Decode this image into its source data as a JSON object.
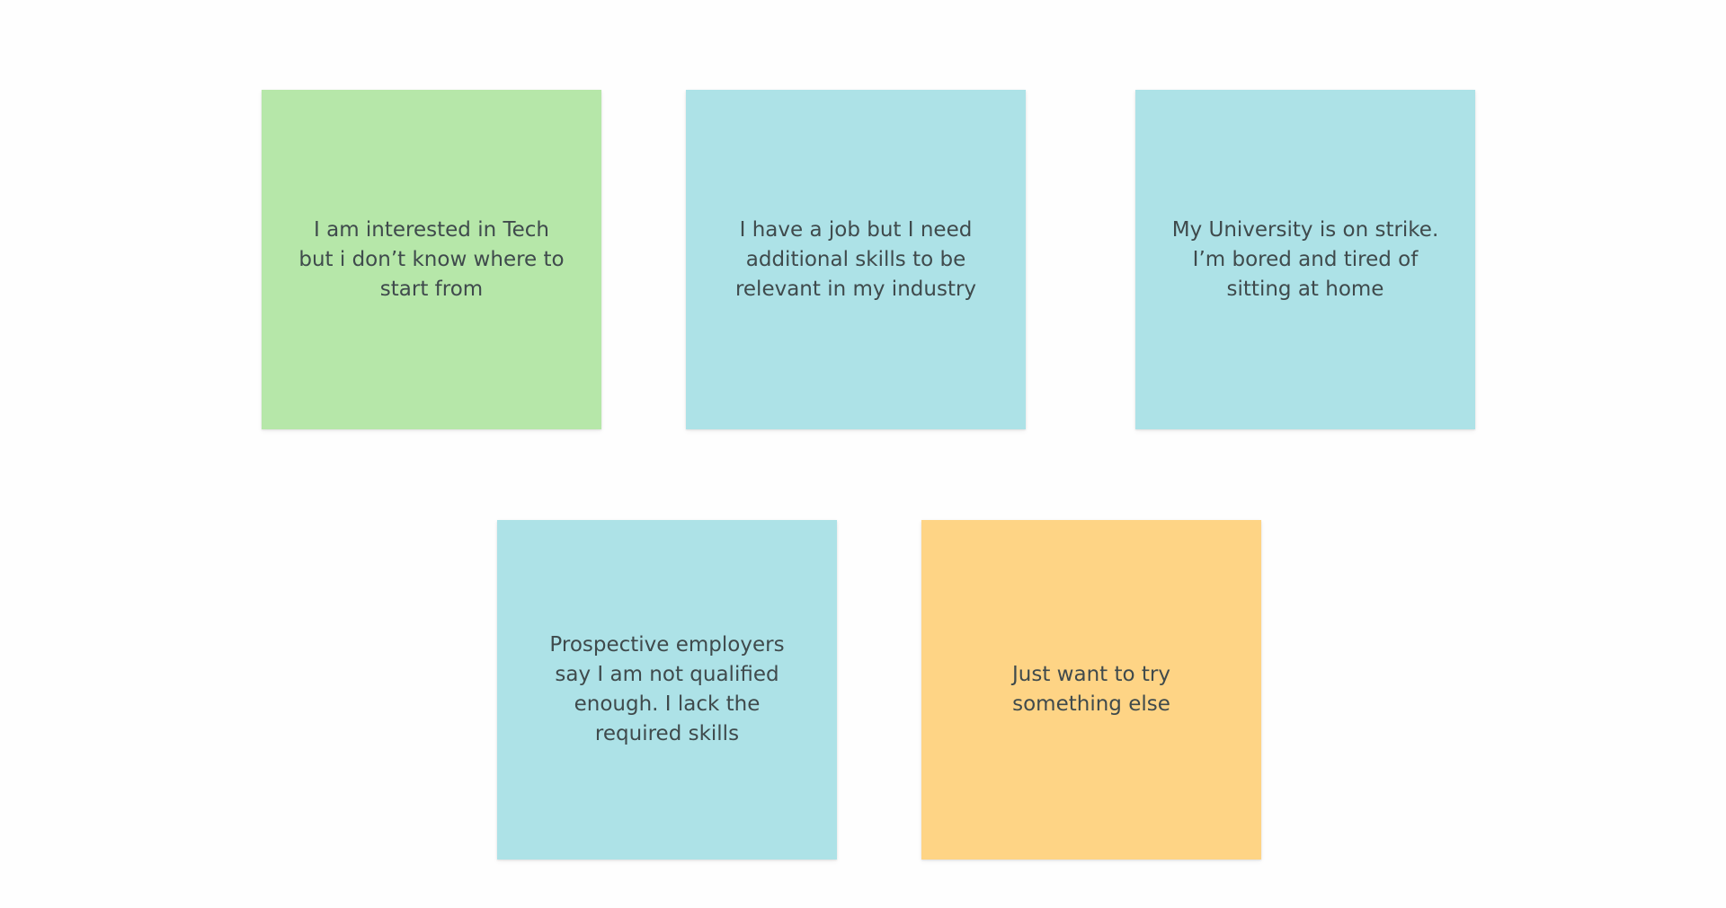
{
  "board": {
    "notes": [
      {
        "text": "I am interested in Tech but i don’t know where to start from",
        "color": "#b6e7a9"
      },
      {
        "text": "I have a job but I need additional skills to be relevant in my industry",
        "color": "#ade2e7"
      },
      {
        "text": "My University is on strike. I’m bored and tired of sitting at home",
        "color": "#ade2e7"
      },
      {
        "text": "Prospective employers say I am not qualified enough. I lack the required skills",
        "color": "#ade2e7"
      },
      {
        "text": "Just want to try something else",
        "color": "#fed485"
      }
    ]
  }
}
